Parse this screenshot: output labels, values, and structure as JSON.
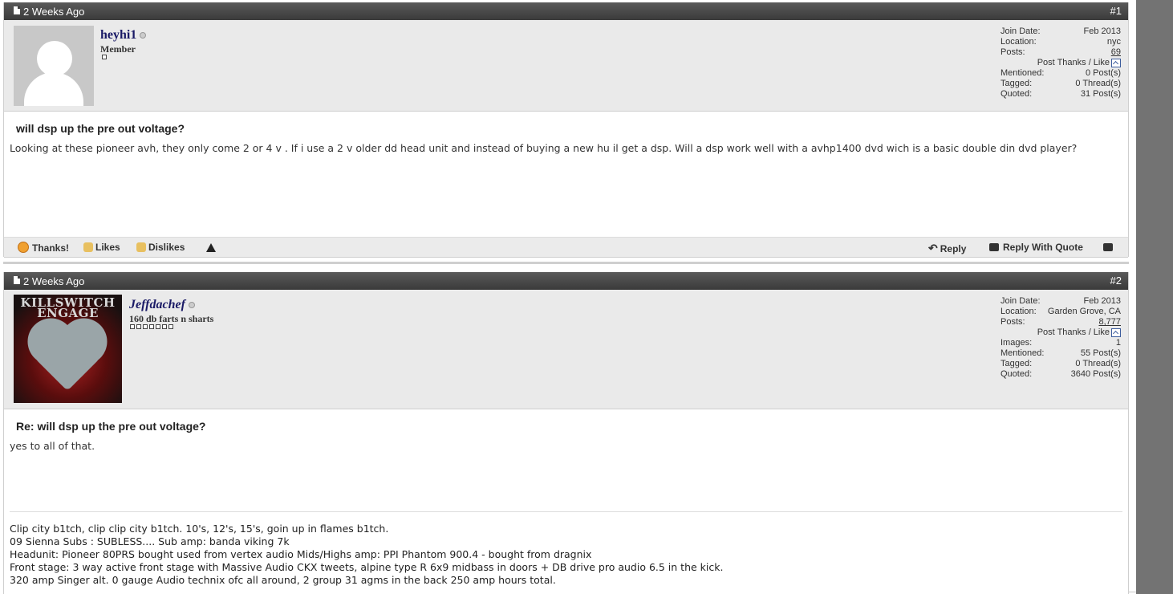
{
  "posts": [
    {
      "date": "2 Weeks Ago",
      "number": "#1",
      "username": "heyhi1",
      "user_title": "Member",
      "avatar": "default-avatar-icon",
      "stats": {
        "join_label": "Join Date:",
        "join_value": "Feb 2013",
        "location_label": "Location:",
        "location_value": "nyc",
        "posts_label": "Posts:",
        "posts_value": "69",
        "thanks_label": "Post Thanks / Like",
        "mentioned_label": "Mentioned:",
        "mentioned_value": "0 Post(s)",
        "tagged_label": "Tagged:",
        "tagged_value": "0 Thread(s)",
        "quoted_label": "Quoted:",
        "quoted_value": "31 Post(s)"
      },
      "title": "will dsp up the pre out voltage?",
      "body": "Looking at these pioneer avh, they only come 2 or 4 v . If i use a 2 v older dd head unit and instead of buying a new hu il get a dsp. Will a dsp work well with a avhp1400 dvd wich is a basic double din dvd player?",
      "actions": {
        "thanks": "Thanks!",
        "likes": "Likes",
        "dislikes": "Dislikes",
        "reply": "Reply",
        "reply_quote": "Reply With Quote"
      }
    },
    {
      "date": "2 Weeks Ago",
      "number": "#2",
      "username": "Jeffdachef",
      "user_title": "160 db farts n sharts",
      "avatar_text": "KILLSWITCH ENGAGE",
      "stats": {
        "join_label": "Join Date:",
        "join_value": "Feb 2013",
        "location_label": "Location:",
        "location_value": "Garden Grove, CA",
        "posts_label": "Posts:",
        "posts_value": "8,777",
        "thanks_label": "Post Thanks / Like",
        "images_label": "Images:",
        "images_value": "1",
        "mentioned_label": "Mentioned:",
        "mentioned_value": "55 Post(s)",
        "tagged_label": "Tagged:",
        "tagged_value": "0 Thread(s)",
        "quoted_label": "Quoted:",
        "quoted_value": "3640 Post(s)"
      },
      "title": "Re: will dsp up the pre out voltage?",
      "body": "yes to all of that.",
      "signature": [
        "Clip city b1tch, clip clip city b1tch. 10's, 12's, 15's, goin up in flames b1tch.",
        "09 Sienna Subs : SUBLESS.... Sub amp: banda viking 7k",
        "Headunit: Pioneer 80PRS bought used from vertex audio Mids/Highs amp: PPI Phantom 900.4 - bought from dragnix",
        "Front stage: 3 way active front stage with Massive Audio CKX tweets, alpine type R 6x9 midbass in doors + DB drive pro audio 6.5 in the kick.",
        "320 amp Singer alt. 0 gauge Audio technix ofc all around, 2 group 31 agms in the back 250 amp hours total."
      ]
    }
  ]
}
